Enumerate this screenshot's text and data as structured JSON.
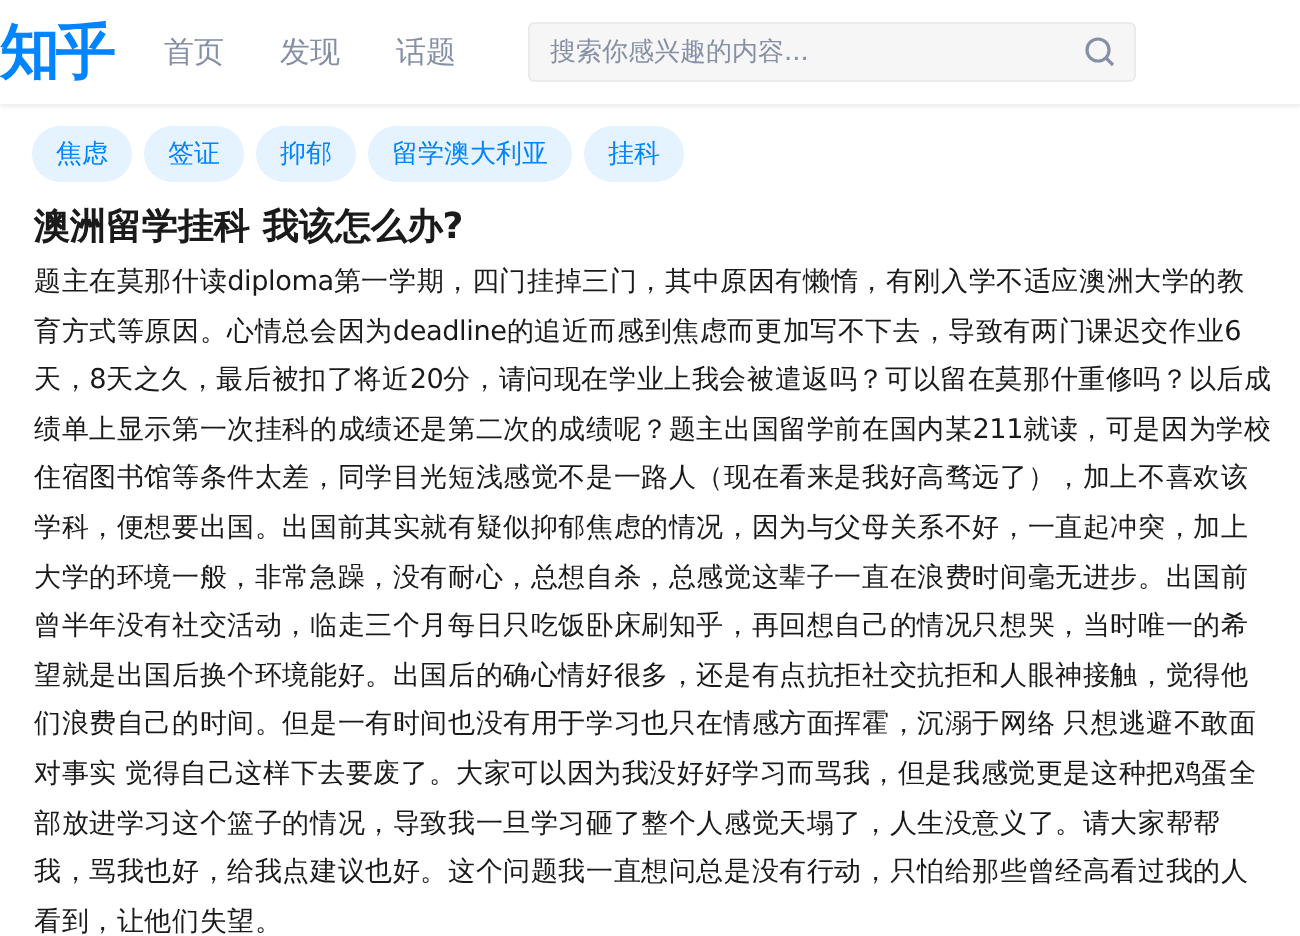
{
  "header": {
    "logo": "知乎",
    "nav": [
      "首页",
      "发现",
      "话题"
    ],
    "search": {
      "placeholder": "搜索你感兴趣的内容..."
    }
  },
  "tags": [
    "焦虑",
    "签证",
    "抑郁",
    "留学澳大利亚",
    "挂科"
  ],
  "question": {
    "title": "澳洲留学挂科 我该怎么办?",
    "body": "题主在莫那什读diploma第一学期，四门挂掉三门，其中原因有懒惰，有刚入学不适应澳洲大学的教育方式等原因。心情总会因为deadline的追近而感到焦虑而更加写不下去，导致有两门课迟交作业6天，8天之久，最后被扣了将近20分，请问现在学业上我会被遣返吗？可以留在莫那什重修吗？以后成绩单上显示第一次挂科的成绩还是第二次的成绩呢？题主出国留学前在国内某211就读，可是因为学校住宿图书馆等条件太差，同学目光短浅感觉不是一路人（现在看来是我好高骛远了），加上不喜欢该学科，便想要出国。出国前其实就有疑似抑郁焦虑的情况，因为与父母关系不好，一直起冲突，加上大学的环境一般，非常急躁，没有耐心，总想自杀，总感觉这辈子一直在浪费时间毫无进步。出国前曾半年没有社交活动，临走三个月每日只吃饭卧床刷知乎，再回想自己的情况只想哭，当时唯一的希望就是出国后换个环境能好。出国后的确心情好很多，还是有点抗拒社交抗拒和人眼神接触，觉得他们浪费自己的时间。但是一有时间也没有用于学习也只在情感方面挥霍，沉溺于网络 只想逃避不敢面对事实 觉得自己这样下去要废了。大家可以因为我没好好学习而骂我，但是我感觉更是这种把鸡蛋全部放进学习这个篮子的情况，导致我一旦学习砸了整个人感觉天塌了，人生没意义了。请大家帮帮我，骂我也好，给我点建议也好。这个问题我一直想问总是没有行动，只怕给那些曾经高看过我的人看到，让他们失望。"
  }
}
